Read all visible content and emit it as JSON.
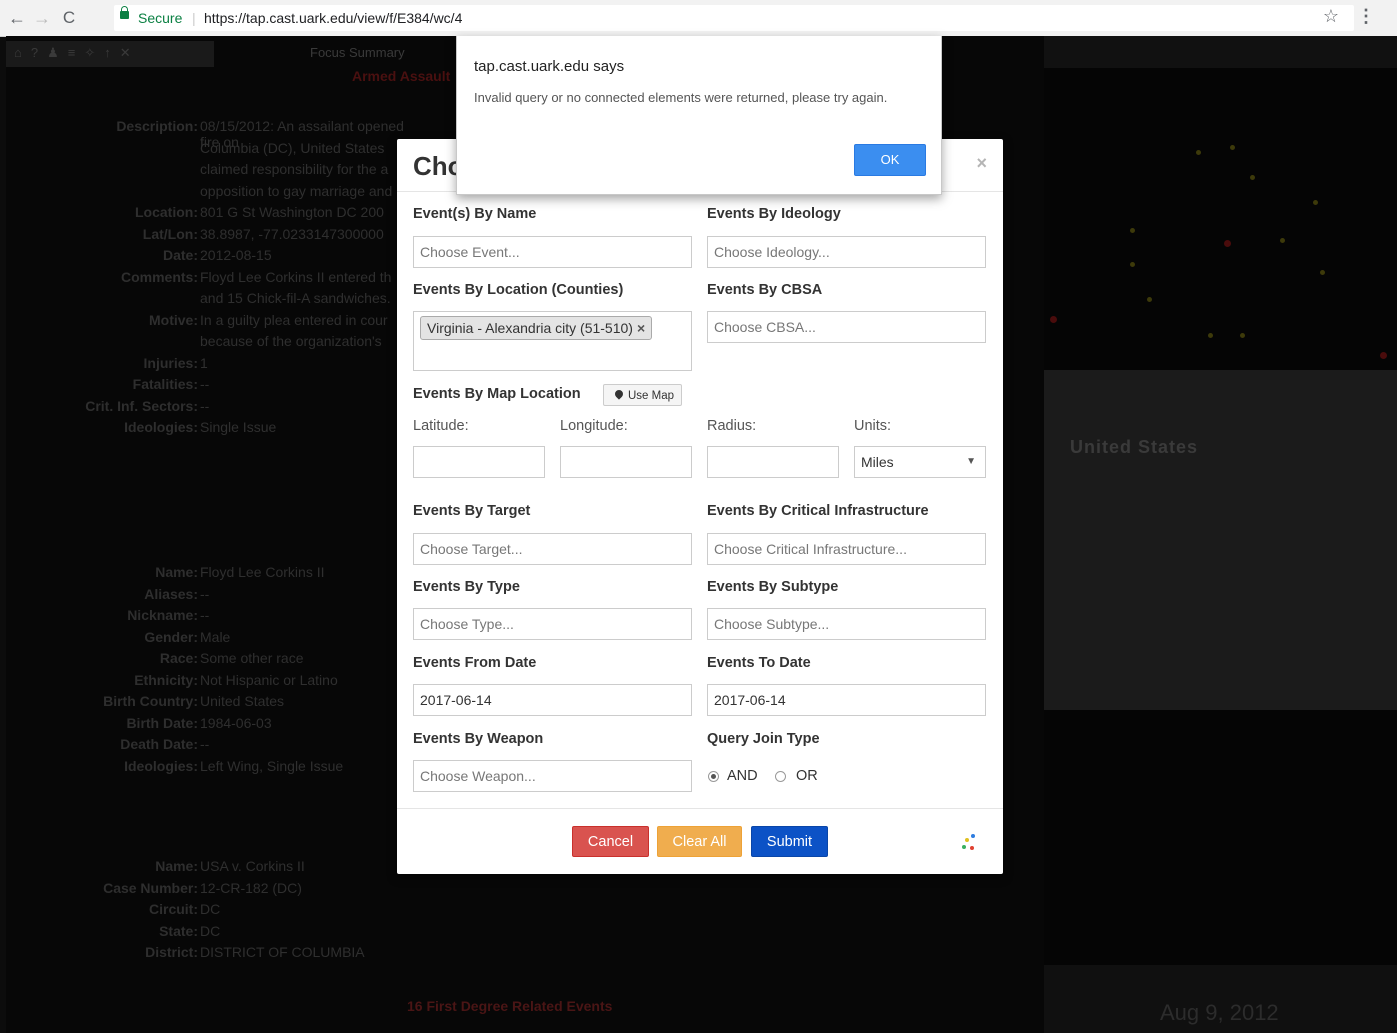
{
  "browser": {
    "secure_label": "Secure",
    "url": "https://tap.cast.uark.edu/view/f/E384/wc/4"
  },
  "background_app": {
    "panel_title": "Focus Summary",
    "event_title": "Armed Assault",
    "event_fields": [
      {
        "k": "Description:",
        "v": "08/15/2012: An assailant opened fire on"
      },
      {
        "k": "",
        "v": "Columbia (DC), United States"
      },
      {
        "k": "",
        "v": "claimed responsibility for the a"
      },
      {
        "k": "",
        "v": "opposition to gay marriage and"
      },
      {
        "k": "Location:",
        "v": "801 G St Washington DC 200"
      },
      {
        "k": "Lat/Lon:",
        "v": "38.8987, -77.0233147300000"
      },
      {
        "k": "Date:",
        "v": "2012-08-15"
      },
      {
        "k": "Comments:",
        "v": "Floyd Lee Corkins II entered th"
      },
      {
        "k": "",
        "v": "and 15 Chick-fil-A sandwiches."
      },
      {
        "k": "Motive:",
        "v": "In a guilty plea entered in cour"
      },
      {
        "k": "",
        "v": "because of the organization's"
      },
      {
        "k": "Injuries:",
        "v": "1"
      },
      {
        "k": "Fatalities:",
        "v": "--"
      },
      {
        "k": "Crit. Inf. Sectors:",
        "v": "--"
      },
      {
        "k": "Ideologies:",
        "v": "Single Issue"
      }
    ],
    "person_fields": [
      {
        "k": "Name:",
        "v": "Floyd Lee Corkins II"
      },
      {
        "k": "Aliases:",
        "v": "--"
      },
      {
        "k": "Nickname:",
        "v": "--"
      },
      {
        "k": "Gender:",
        "v": "Male"
      },
      {
        "k": "Race:",
        "v": "Some other race"
      },
      {
        "k": "Ethnicity:",
        "v": "Not Hispanic or Latino"
      },
      {
        "k": "Birth Country:",
        "v": "United States"
      },
      {
        "k": "Birth Date:",
        "v": "1984-06-03"
      },
      {
        "k": "Death Date:",
        "v": "--"
      },
      {
        "k": "Ideologies:",
        "v": "Left Wing, Single Issue"
      }
    ],
    "case_fields": [
      {
        "k": "Name:",
        "v": "USA v. Corkins II"
      },
      {
        "k": "Case Number:",
        "v": "12-CR-182 (DC)"
      },
      {
        "k": "Circuit:",
        "v": "DC"
      },
      {
        "k": "State:",
        "v": "DC"
      },
      {
        "k": "District:",
        "v": "DISTRICT OF COLUMBIA"
      }
    ],
    "related_events": "16 First Degree Related Events",
    "map_country_label": "United States",
    "timeline_date": "Aug 9, 2012"
  },
  "modal": {
    "title": "Choose Events",
    "close_glyph": "×",
    "labels": {
      "by_name": "Event(s) By Name",
      "by_ideology": "Events By Ideology",
      "by_location": "Events By Location (Counties)",
      "by_cbsa": "Events By CBSA",
      "by_map_location": "Events By Map Location",
      "latitude": "Latitude:",
      "longitude": "Longitude:",
      "radius": "Radius:",
      "units": "Units:",
      "by_target": "Events By Target",
      "by_critical_infrastructure": "Events By Critical Infrastructure",
      "by_type": "Events By Type",
      "by_subtype": "Events By Subtype",
      "from_date": "Events From Date",
      "to_date": "Events To Date",
      "by_weapon": "Events By Weapon",
      "join_type": "Query Join Type"
    },
    "placeholders": {
      "event": "Choose Event...",
      "ideology": "Choose Ideology...",
      "cbsa": "Choose CBSA...",
      "target": "Choose Target...",
      "critical_infrastructure": "Choose Critical Infrastructure...",
      "type": "Choose Type...",
      "subtype": "Choose Subtype...",
      "weapon": "Choose Weapon..."
    },
    "location_tag": "Virginia - Alexandria city (51-510)",
    "use_map_label": "Use Map",
    "units_value": "Miles",
    "from_date_value": "2017-06-14",
    "to_date_value": "2017-06-14",
    "join_options": [
      {
        "label": "AND",
        "selected": true
      },
      {
        "label": "OR",
        "selected": false
      }
    ],
    "buttons": {
      "cancel": "Cancel",
      "clear_all": "Clear All",
      "submit": "Submit"
    }
  },
  "alert": {
    "title": "tap.cast.uark.edu says",
    "message": "Invalid query or no connected elements were returned, please try again.",
    "ok": "OK"
  },
  "colors": {
    "cancel": "#d9534f",
    "clear_all": "#f0ad4e",
    "submit": "#0c52c6",
    "alert_ok": "#3b8ef0",
    "secure_green": "#0b8043"
  }
}
